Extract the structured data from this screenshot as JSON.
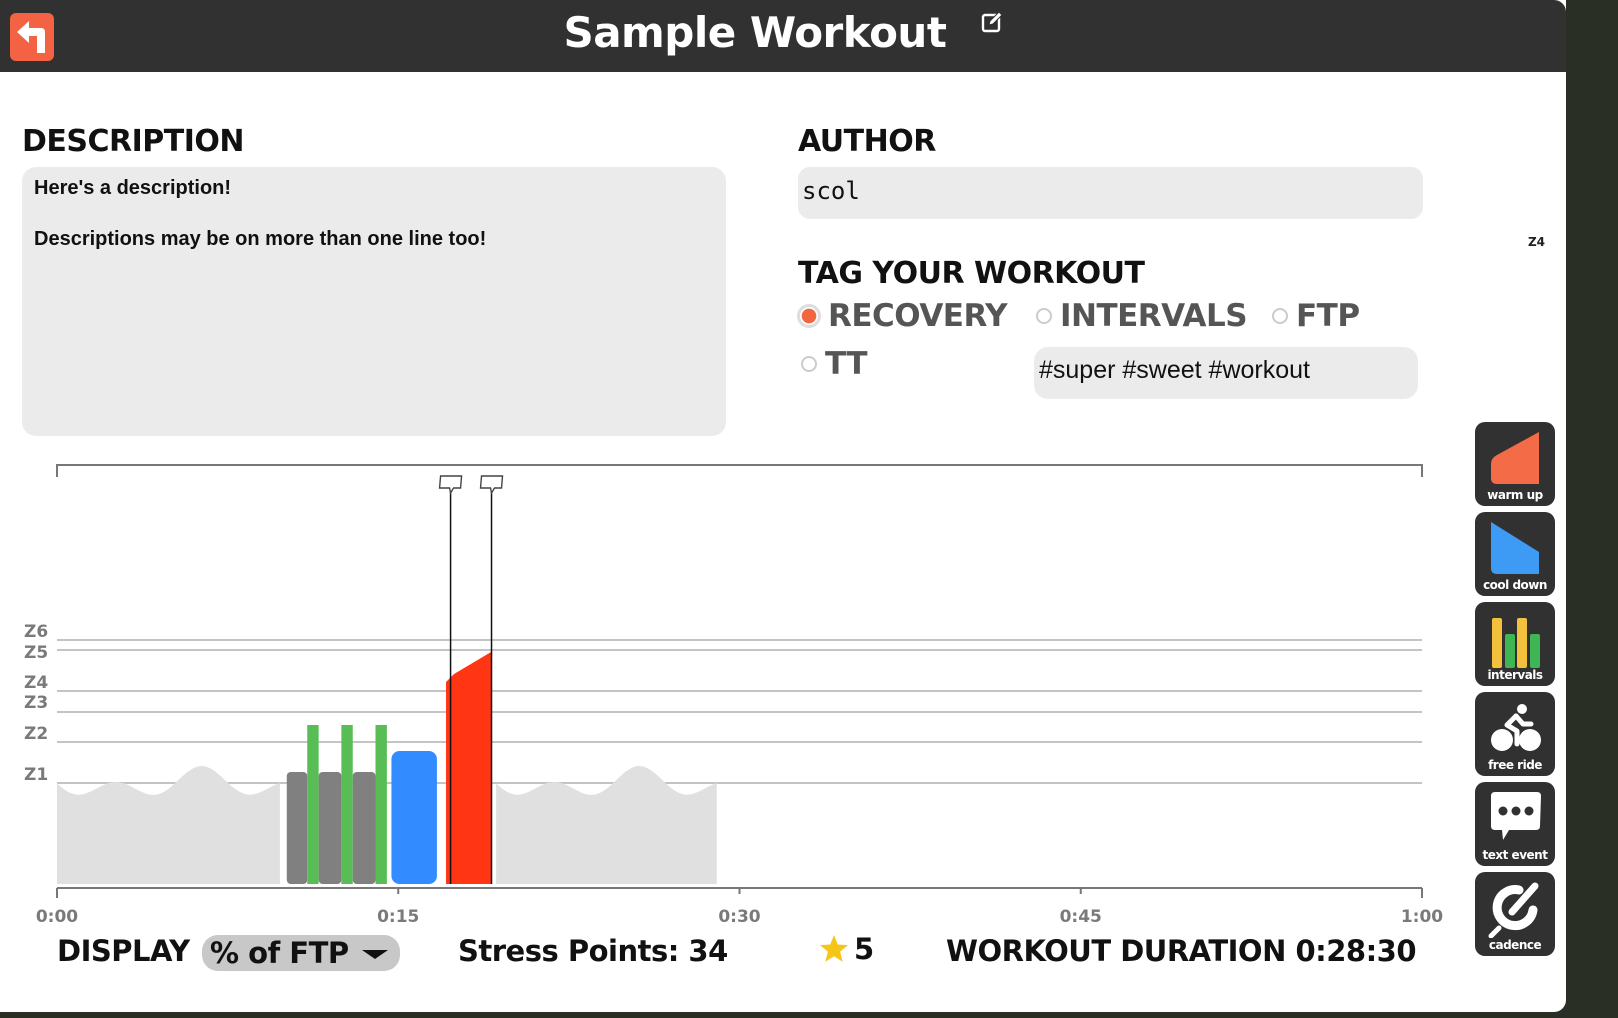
{
  "header": {
    "title": "Sample Workout",
    "back_icon": "back-arrow-icon",
    "edit_icon": "edit-pencil-icon"
  },
  "description": {
    "heading": "DESCRIPTION",
    "lines": [
      "Here's a description!",
      "Descriptions may be on more than one line too!"
    ]
  },
  "author": {
    "heading": "AUTHOR",
    "value": "scol"
  },
  "tags": {
    "heading": "TAG YOUR WORKOUT",
    "options": [
      {
        "label": "RECOVERY",
        "selected": true
      },
      {
        "label": "INTERVALS",
        "selected": false
      },
      {
        "label": "FTP",
        "selected": false
      },
      {
        "label": "TT",
        "selected": false
      }
    ],
    "hashtags": "#super #sweet #workout"
  },
  "chart_data": {
    "type": "area",
    "title": "",
    "xlabel": "",
    "ylabel": "",
    "x_unit": "minutes",
    "xlim": [
      0,
      60
    ],
    "x_ticks": [
      "0:00",
      "0:15",
      "0:30",
      "0:45",
      "1:00"
    ],
    "zone_labels": [
      "Z1",
      "Z2",
      "Z3",
      "Z4",
      "Z5",
      "Z6"
    ],
    "zone_boundaries_pct_ftp": [
      60,
      75,
      90,
      105,
      118,
      128
    ],
    "segments": [
      {
        "type": "free ride",
        "start": 0,
        "end": 9.8,
        "color": "#e0e0e0"
      },
      {
        "type": "steady",
        "zone": "Z1",
        "start": 10.1,
        "end": 11.0,
        "power_pct": 55,
        "color": "#808080"
      },
      {
        "type": "steady",
        "zone": "Z3",
        "start": 11.0,
        "end": 11.5,
        "power_pct": 80,
        "color": "#57bd54"
      },
      {
        "type": "steady",
        "zone": "Z1",
        "start": 11.5,
        "end": 12.5,
        "power_pct": 55,
        "color": "#808080"
      },
      {
        "type": "steady",
        "zone": "Z3",
        "start": 12.5,
        "end": 13.0,
        "power_pct": 80,
        "color": "#57bd54"
      },
      {
        "type": "steady",
        "zone": "Z1",
        "start": 13.0,
        "end": 14.0,
        "power_pct": 55,
        "color": "#808080"
      },
      {
        "type": "steady",
        "zone": "Z3",
        "start": 14.0,
        "end": 14.5,
        "power_pct": 80,
        "color": "#57bd54"
      },
      {
        "type": "steady",
        "zone": "Z2",
        "start": 14.7,
        "end": 16.7,
        "power_pct": 65,
        "color": "#338cff"
      },
      {
        "type": "warm up",
        "zone": "Z6",
        "start": 17.1,
        "end": 19.1,
        "power_start_pct": 120,
        "power_end_pct": 138,
        "color": "#ff3514"
      },
      {
        "type": "free ride",
        "start": 19.3,
        "end": 29.0,
        "color": "#e0e0e0"
      }
    ],
    "text_events": [
      {
        "time": 17.3
      },
      {
        "time": 19.1
      }
    ]
  },
  "footer": {
    "display_label": "DISPLAY",
    "display_value": "% of FTP",
    "stress_points": "Stress Points: 34",
    "rating": "5",
    "rating_icon": "star-icon",
    "duration": "WORKOUT DURATION 0:28:30"
  },
  "palette": {
    "zones": [
      {
        "label": "Z1",
        "color": "#7d7a7d"
      },
      {
        "label": "Z2",
        "color": "#3f8bd5"
      },
      {
        "label": "Z3",
        "color": "#4bc26f"
      },
      {
        "label": "Z4",
        "color": "#ffcb3e"
      },
      {
        "label": "Z5",
        "color": "#f46b47"
      },
      {
        "label": "Z6",
        "color": "#d7270d"
      }
    ],
    "tools": [
      {
        "label": "warm up",
        "icon": "warm-up-icon"
      },
      {
        "label": "cool down",
        "icon": "cool-down-icon"
      },
      {
        "label": "intervals",
        "icon": "intervals-icon"
      },
      {
        "label": "free ride",
        "icon": "cyclist-icon"
      },
      {
        "label": "text event",
        "icon": "speech-bubble-icon"
      },
      {
        "label": "cadence",
        "icon": "cadence-icon"
      }
    ]
  }
}
